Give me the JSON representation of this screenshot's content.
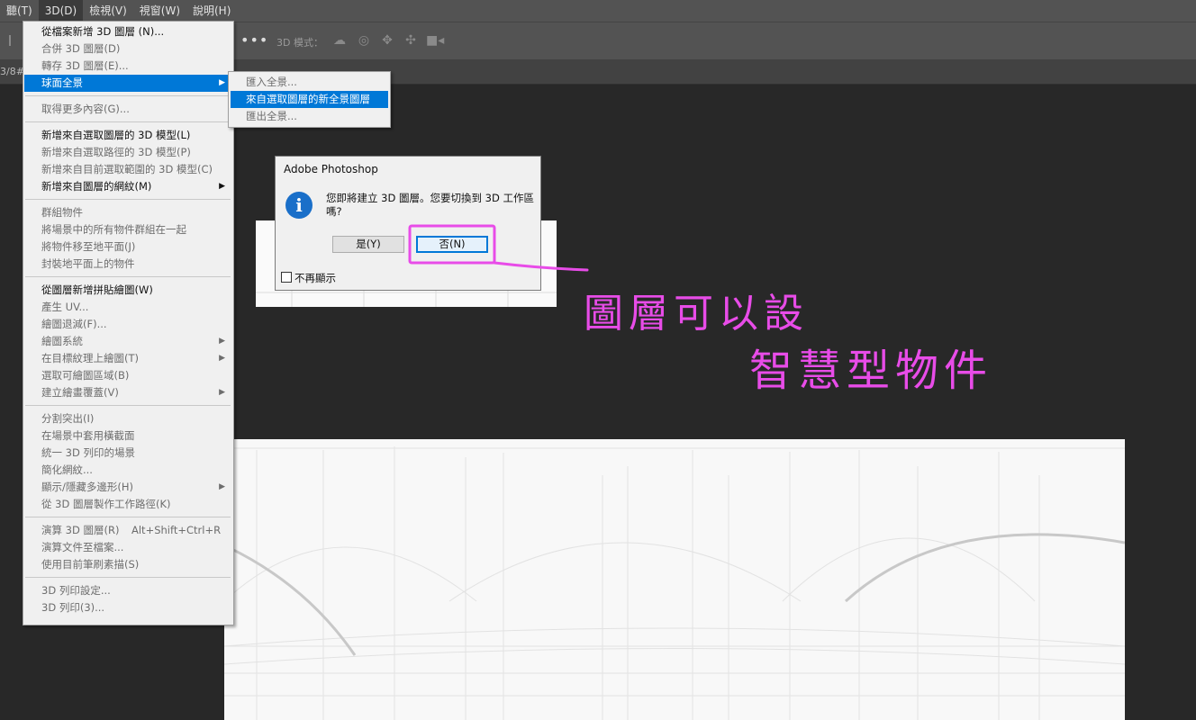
{
  "menubar": {
    "items": [
      "聽(T)",
      "3D(D)",
      "檢視(V)",
      "視窗(W)",
      "說明(H)"
    ],
    "active_index": 1
  },
  "options_bar": {
    "more_icon": "more-dots-icon",
    "mode_label": "3D 模式：",
    "icons": [
      "orbit-icon",
      "roll-icon",
      "pan-icon",
      "slide-icon",
      "camera-icon"
    ]
  },
  "tab_text": "3/8#)",
  "menu_3d": {
    "items": [
      {
        "label": "從檔案新增 3D 圖層 (N)...",
        "enabled": true
      },
      {
        "label": "合併 3D 圖層(D)",
        "enabled": false
      },
      {
        "label": "轉存 3D 圖層(E)...",
        "enabled": false
      },
      {
        "label": "球面全景",
        "enabled": true,
        "submenu": true,
        "highlighted": true
      },
      {
        "sep": true
      },
      {
        "label": "取得更多內容(G)...",
        "enabled": false
      },
      {
        "sep": true
      },
      {
        "label": "新增來自選取圖層的 3D 模型(L)",
        "enabled": true
      },
      {
        "label": "新增來自選取路徑的 3D 模型(P)",
        "enabled": false
      },
      {
        "label": "新增來自目前選取範圍的 3D 模型(C)",
        "enabled": false
      },
      {
        "label": "新增來自圖層的網紋(M)",
        "enabled": true,
        "submenu": true
      },
      {
        "sep": true
      },
      {
        "label": "群組物件",
        "enabled": false
      },
      {
        "label": "將場景中的所有物件群組在一起",
        "enabled": false
      },
      {
        "label": "將物件移至地平面(J)",
        "enabled": false
      },
      {
        "label": "封裝地平面上的物件",
        "enabled": false
      },
      {
        "sep": true
      },
      {
        "label": "從圖層新增拼貼繪圖(W)",
        "enabled": true
      },
      {
        "label": "產生 UV...",
        "enabled": false
      },
      {
        "label": "繪圖退減(F)...",
        "enabled": false
      },
      {
        "label": "繪圖系統",
        "enabled": false,
        "submenu": true
      },
      {
        "label": "在目標紋理上繪圖(T)",
        "enabled": false,
        "submenu": true
      },
      {
        "label": "選取可繪圖區域(B)",
        "enabled": false
      },
      {
        "label": "建立繪畫覆蓋(V)",
        "enabled": false,
        "submenu": true
      },
      {
        "sep": true
      },
      {
        "label": "分割突出(I)",
        "enabled": false
      },
      {
        "label": "在場景中套用橫截面",
        "enabled": false
      },
      {
        "label": "統一 3D 列印的場景",
        "enabled": false
      },
      {
        "label": "簡化網紋...",
        "enabled": false
      },
      {
        "label": "顯示/隱藏多邊形(H)",
        "enabled": false,
        "submenu": true
      },
      {
        "label": "從 3D 圖層製作工作路徑(K)",
        "enabled": false
      },
      {
        "sep": true
      },
      {
        "label": "演算 3D 圖層(R)",
        "enabled": false,
        "shortcut": "Alt+Shift+Ctrl+R"
      },
      {
        "label": "演算文件至檔案...",
        "enabled": false
      },
      {
        "label": "使用目前筆刷素描(S)",
        "enabled": false
      },
      {
        "sep": true
      },
      {
        "label": "3D 列印設定...",
        "enabled": false
      },
      {
        "label": "3D 列印(3)...",
        "enabled": false
      }
    ]
  },
  "submenu_panorama": {
    "items": [
      {
        "label": "匯入全景...",
        "enabled": false
      },
      {
        "label": "來自選取圖層的新全景圖層",
        "enabled": true,
        "highlighted": true
      },
      {
        "label": "匯出全景...",
        "enabled": false
      }
    ]
  },
  "dialog": {
    "title": "Adobe Photoshop",
    "message": "您即將建立 3D 圖層。您要切換到 3D 工作區嗎?",
    "yes_label": "是(Y)",
    "no_label": "否(N)",
    "checkbox_label": "不再顯示",
    "icon": "info-icon"
  },
  "annotation": {
    "line1": "圖層可以設",
    "line2": "智慧型物件",
    "color": "#e84ce8"
  }
}
